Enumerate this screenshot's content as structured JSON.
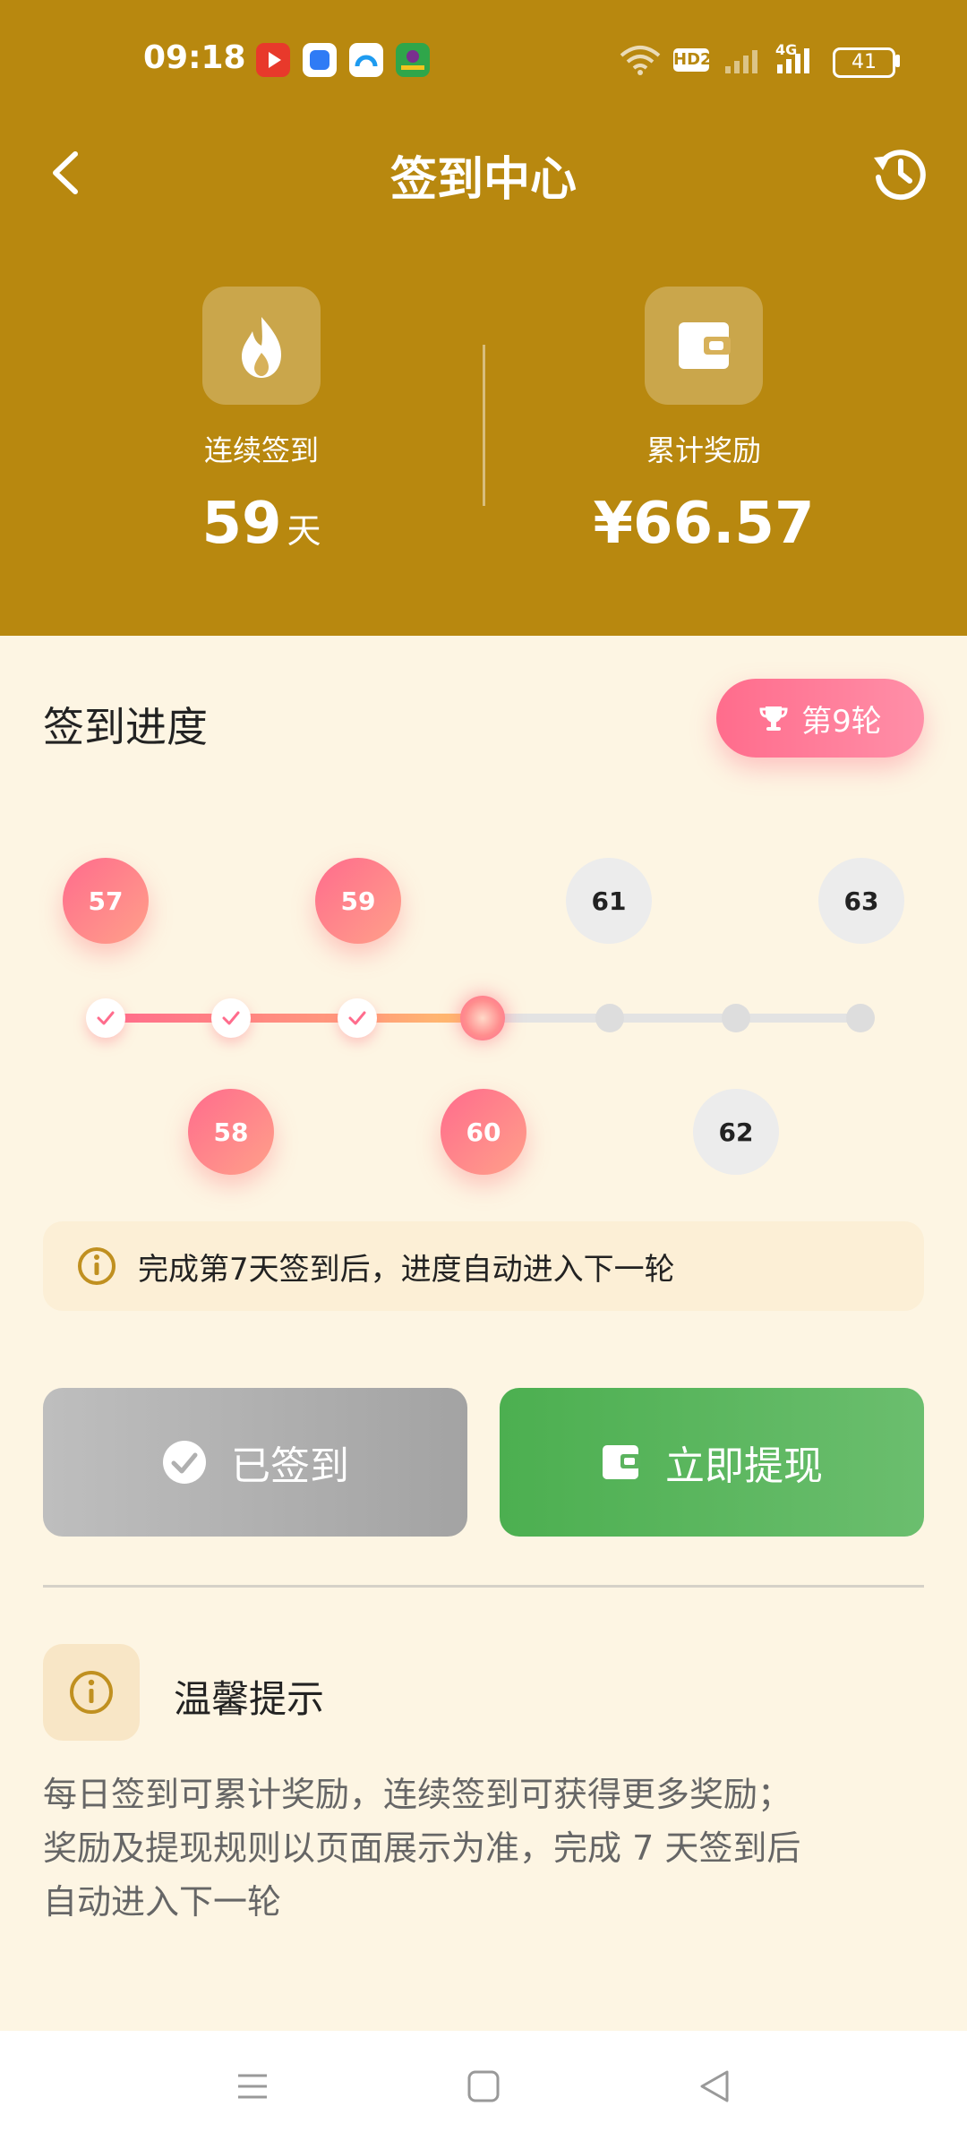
{
  "status_bar": {
    "time": "09:18",
    "battery": "41",
    "network": "4G",
    "hd_label": "HD2",
    "icons": [
      "app-icon-red-play",
      "app-icon-blue",
      "app-icon-white-blue",
      "app-icon-green"
    ]
  },
  "header": {
    "title": "签到中心",
    "back_icon": "chevron-left-icon",
    "history_icon": "history-icon"
  },
  "stats": {
    "streak_label": "连续签到",
    "streak_value": "59",
    "streak_unit": "天",
    "total_label": "累计奖励",
    "total_value": "¥66.57",
    "streak_icon": "flame-icon",
    "total_icon": "wallet-icon"
  },
  "progress": {
    "title": "签到进度",
    "round_label": "第9轮",
    "round_icon": "trophy-icon",
    "days_top": [
      "57",
      "59",
      "61",
      "63"
    ],
    "days_bottom": [
      "58",
      "60",
      "62"
    ],
    "completed_nodes": 3,
    "current_node": 4,
    "total_nodes": 7
  },
  "tip": {
    "text": "完成第7天签到后，进度自动进入下一轮",
    "icon": "info-icon"
  },
  "buttons": {
    "signed_label": "已签到",
    "signed_icon": "check-circle-icon",
    "withdraw_label": "立即提现",
    "withdraw_icon": "wallet-icon"
  },
  "notice": {
    "title": "温馨提示",
    "icon": "info-icon",
    "line1": "每日签到可累计奖励，连续签到可获得更多奖励；",
    "line2": "奖励及提现规则以页面展示为准，完成 7 天签到后",
    "line3": "自动进入下一轮"
  },
  "colors": {
    "header_bg": "#B8880F",
    "page_bg": "#FDF5E3",
    "accent_pink": "#FF6C8C",
    "withdraw_green": "#4CAF50"
  }
}
